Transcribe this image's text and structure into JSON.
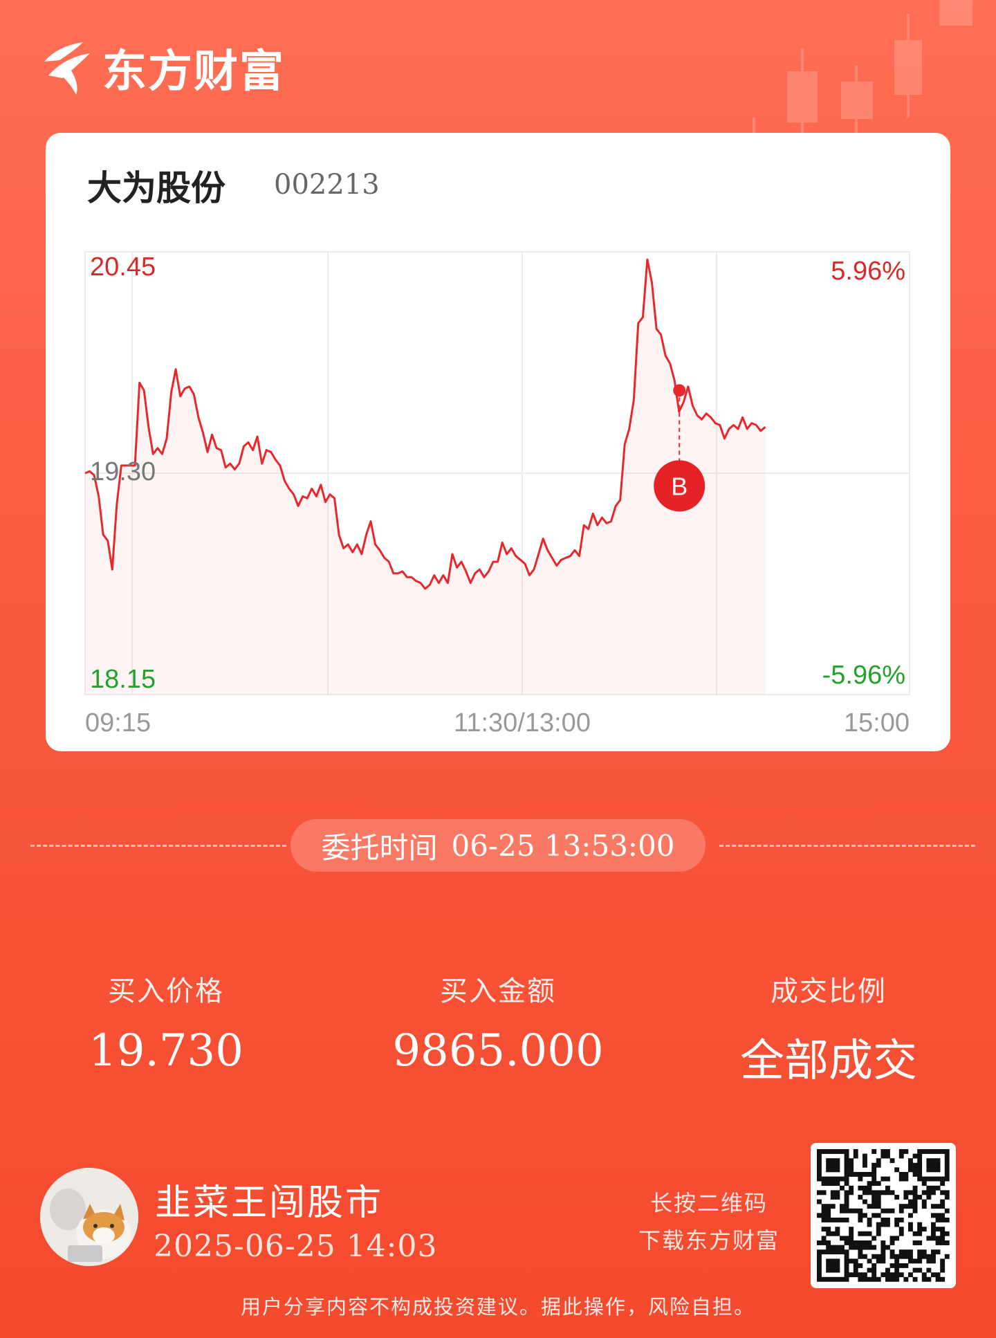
{
  "brand": {
    "name": "东方财富",
    "logo_icon": "eastmoney-logo-icon"
  },
  "stock": {
    "name": "大为股份",
    "code": "002213"
  },
  "chart_data": {
    "type": "line",
    "y_left_ticks": [
      "20.45",
      "19.30",
      "18.15"
    ],
    "y_right_ticks": [
      "5.96%",
      "-5.96%"
    ],
    "x_ticks": [
      "09:15",
      "11:30/13:00",
      "15:00"
    ],
    "ylim": [
      18.15,
      20.45
    ],
    "prev_close": 19.3,
    "series": [
      {
        "values": [
          19.3,
          19.31,
          19.29,
          19.18,
          18.98,
          18.95,
          18.8,
          19.14,
          19.34,
          19.34,
          19.34,
          19.34,
          19.77,
          19.73,
          19.54,
          19.4,
          19.43,
          19.4,
          19.48,
          19.72,
          19.84,
          19.7,
          19.74,
          19.75,
          19.71,
          19.59,
          19.51,
          19.41,
          19.5,
          19.43,
          19.42,
          19.33,
          19.35,
          19.32,
          19.35,
          19.44,
          19.46,
          19.42,
          19.49,
          19.35,
          19.42,
          19.41,
          19.37,
          19.34,
          19.26,
          19.22,
          19.19,
          19.13,
          19.18,
          19.17,
          19.22,
          19.18,
          19.24,
          19.15,
          19.19,
          19.17,
          18.98,
          18.91,
          18.93,
          18.89,
          18.93,
          18.88,
          18.98,
          19.05,
          18.93,
          18.9,
          18.86,
          18.84,
          18.78,
          18.78,
          18.79,
          18.76,
          18.76,
          18.74,
          18.73,
          18.7,
          18.72,
          18.77,
          18.73,
          18.77,
          18.73,
          18.88,
          18.81,
          18.84,
          18.79,
          18.73,
          18.78,
          18.8,
          18.76,
          18.79,
          18.84,
          18.84,
          18.94,
          18.88,
          18.91,
          18.87,
          18.85,
          18.83,
          18.77,
          18.8,
          18.88,
          18.96,
          18.9,
          18.86,
          18.82,
          18.85,
          18.86,
          18.87,
          18.9,
          18.87,
          19.03,
          19.01,
          19.09,
          19.03,
          19.07,
          19.04,
          19.05,
          19.13,
          19.16,
          19.45,
          19.53,
          19.68,
          20.08,
          20.11,
          20.41,
          20.29,
          20.05,
          20.02,
          19.91,
          19.87,
          19.78,
          19.62,
          19.67,
          19.75,
          19.65,
          19.6,
          19.58,
          19.61,
          19.59,
          19.56,
          19.55,
          19.48,
          19.53,
          19.55,
          19.53,
          19.59,
          19.53,
          19.56,
          19.55,
          19.52,
          19.54
        ]
      }
    ],
    "markers": [
      {
        "label": "B",
        "price": 19.73,
        "time": "13:53"
      }
    ],
    "colors": {
      "line": "#e8262d",
      "up_text": "#d62a2a",
      "down_text": "#22a22a",
      "neutral_text": "#777777"
    }
  },
  "order": {
    "label": "委托时间",
    "datetime": "06-25 13:53:00"
  },
  "stats": [
    {
      "label": "买入价格",
      "value": "19.730"
    },
    {
      "label": "买入金额",
      "value": "9865.000"
    },
    {
      "label": "成交比例",
      "value": "全部成交"
    }
  ],
  "user": {
    "name": "韭菜王闯股市",
    "timestamp": "2025-06-25 14:03",
    "avatar_icon": "cat-avatar-icon"
  },
  "qr_hint": {
    "line1": "长按二维码",
    "line2": "下载东方财富",
    "qr_icon": "qr-code-icon"
  },
  "disclaimer": "用户分享内容不构成投资建议。据此操作，风险自担。"
}
